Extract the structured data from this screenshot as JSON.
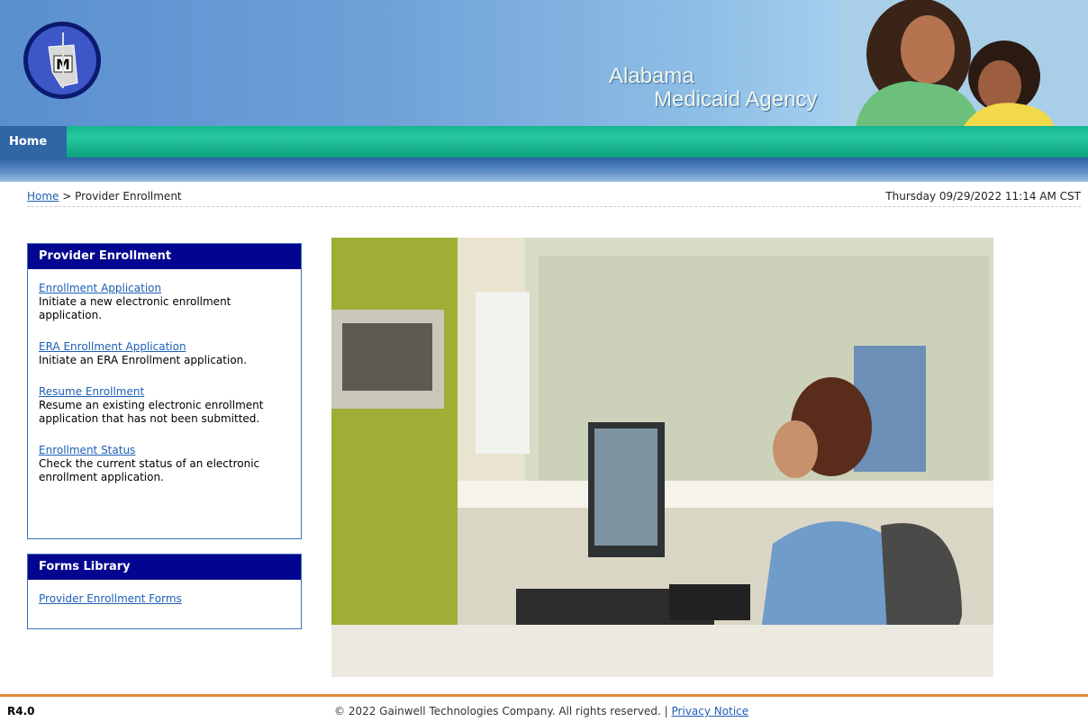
{
  "header": {
    "agency_line1": "Alabama",
    "agency_line2": "Medicaid Agency",
    "logo_letter": "M"
  },
  "nav": {
    "home": "Home"
  },
  "breadcrumb": {
    "home_link": "Home",
    "separator": ">",
    "current": "Provider Enrollment"
  },
  "datetime": "Thursday 09/29/2022 11:14 AM CST",
  "provider_box": {
    "title": "Provider Enrollment",
    "items": [
      {
        "link": "Enrollment Application",
        "desc": "Initiate a new electronic enrollment application."
      },
      {
        "link": "ERA Enrollment Application",
        "desc": "Initiate an ERA Enrollment application."
      },
      {
        "link": "Resume Enrollment",
        "desc": "Resume an existing electronic enrollment application that has not been submitted."
      },
      {
        "link": "Enrollment Status",
        "desc": "Check the current status of an electronic enrollment application."
      }
    ]
  },
  "forms_box": {
    "title": "Forms Library",
    "link": "Provider Enrollment Forms"
  },
  "footer": {
    "version": "R4.0",
    "copyright": "© 2022 Gainwell Technologies Company. All rights reserved. |",
    "privacy": "Privacy Notice"
  }
}
